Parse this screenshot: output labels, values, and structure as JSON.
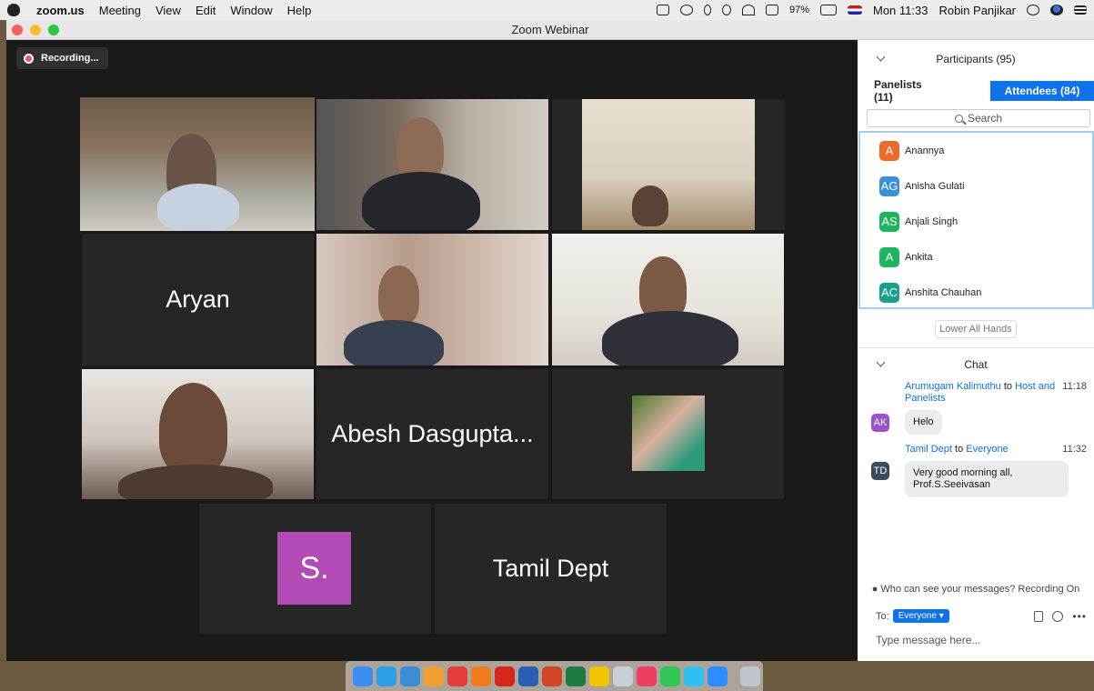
{
  "menubar": {
    "items": [
      "zoom.us",
      "Meeting",
      "View",
      "Edit",
      "Window",
      "Help"
    ],
    "battery": "97%",
    "clock": "Mon 11:33",
    "user": "Robin Panjikar"
  },
  "window": {
    "title": "Zoom Webinar"
  },
  "video": {
    "recording_label": "Recording...",
    "tiles": [
      {
        "label": ""
      },
      {
        "label": ""
      },
      {
        "label": ""
      },
      {
        "label": "Aryan"
      },
      {
        "label": ""
      },
      {
        "label": ""
      },
      {
        "label": ""
      },
      {
        "label": "Abesh Dasgupta..."
      },
      {
        "label": ""
      },
      {
        "label": ""
      },
      {
        "label": "Tamil Dept"
      }
    ],
    "s_avatar": "S."
  },
  "participants": {
    "header": "Participants (95)",
    "tab_panelists": "Panelists (11)",
    "tab_attendees": "Attendees (84)",
    "search_placeholder": "Search",
    "list": [
      {
        "initials": "A",
        "name": "Anannya",
        "color": "#ee6a2a"
      },
      {
        "initials": "AG",
        "name": "Anisha Gulati",
        "color": "#3a8fd9"
      },
      {
        "initials": "AS",
        "name": "Anjali Singh",
        "color": "#1db65f"
      },
      {
        "initials": "A",
        "name": "Ankita",
        "color": "#1db65f"
      },
      {
        "initials": "AC",
        "name": "Anshita Chauhan",
        "color": "#1aa08a"
      }
    ],
    "lower_hands": "Lower All Hands"
  },
  "chat": {
    "header": "Chat",
    "messages": [
      {
        "sender": "Arumugam Kalimuthu",
        "to_word": "to",
        "recipient": "Host and Panelists",
        "time": "11:18",
        "initials": "AK",
        "avatar_color": "#9b51c9",
        "text": "Helo"
      },
      {
        "sender": "Tamil Dept",
        "to_word": "to",
        "recipient": "Everyone",
        "time": "11:32",
        "initials": "TD",
        "avatar_color": "#3a4a5c",
        "text": "Very good morning all, Prof.S.Seeivasan"
      }
    ],
    "visibility_notice": "Who can see your messages? Recording On",
    "to_label": "To:",
    "to_target": "Everyone",
    "input_placeholder": "Type message here..."
  },
  "dock": {
    "apps": [
      "finder",
      "safari",
      "preview",
      "photos",
      "chrome",
      "books",
      "acrobat",
      "word",
      "powerpoint",
      "excel",
      "notes",
      "preview-docs",
      "music",
      "facetime",
      "messages",
      "zoom",
      "trash"
    ],
    "colors": [
      "#3b8ef0",
      "#2c9ee6",
      "#3d8dd6",
      "#f0a030",
      "#e23f3a",
      "#f07b1a",
      "#d9261c",
      "#2b5fb4",
      "#d14424",
      "#1f7a43",
      "#f0c400",
      "#c6cfd8",
      "#ef3e61",
      "#31c758",
      "#30c0f0",
      "#2d8cff",
      "#bfc5cc"
    ]
  }
}
